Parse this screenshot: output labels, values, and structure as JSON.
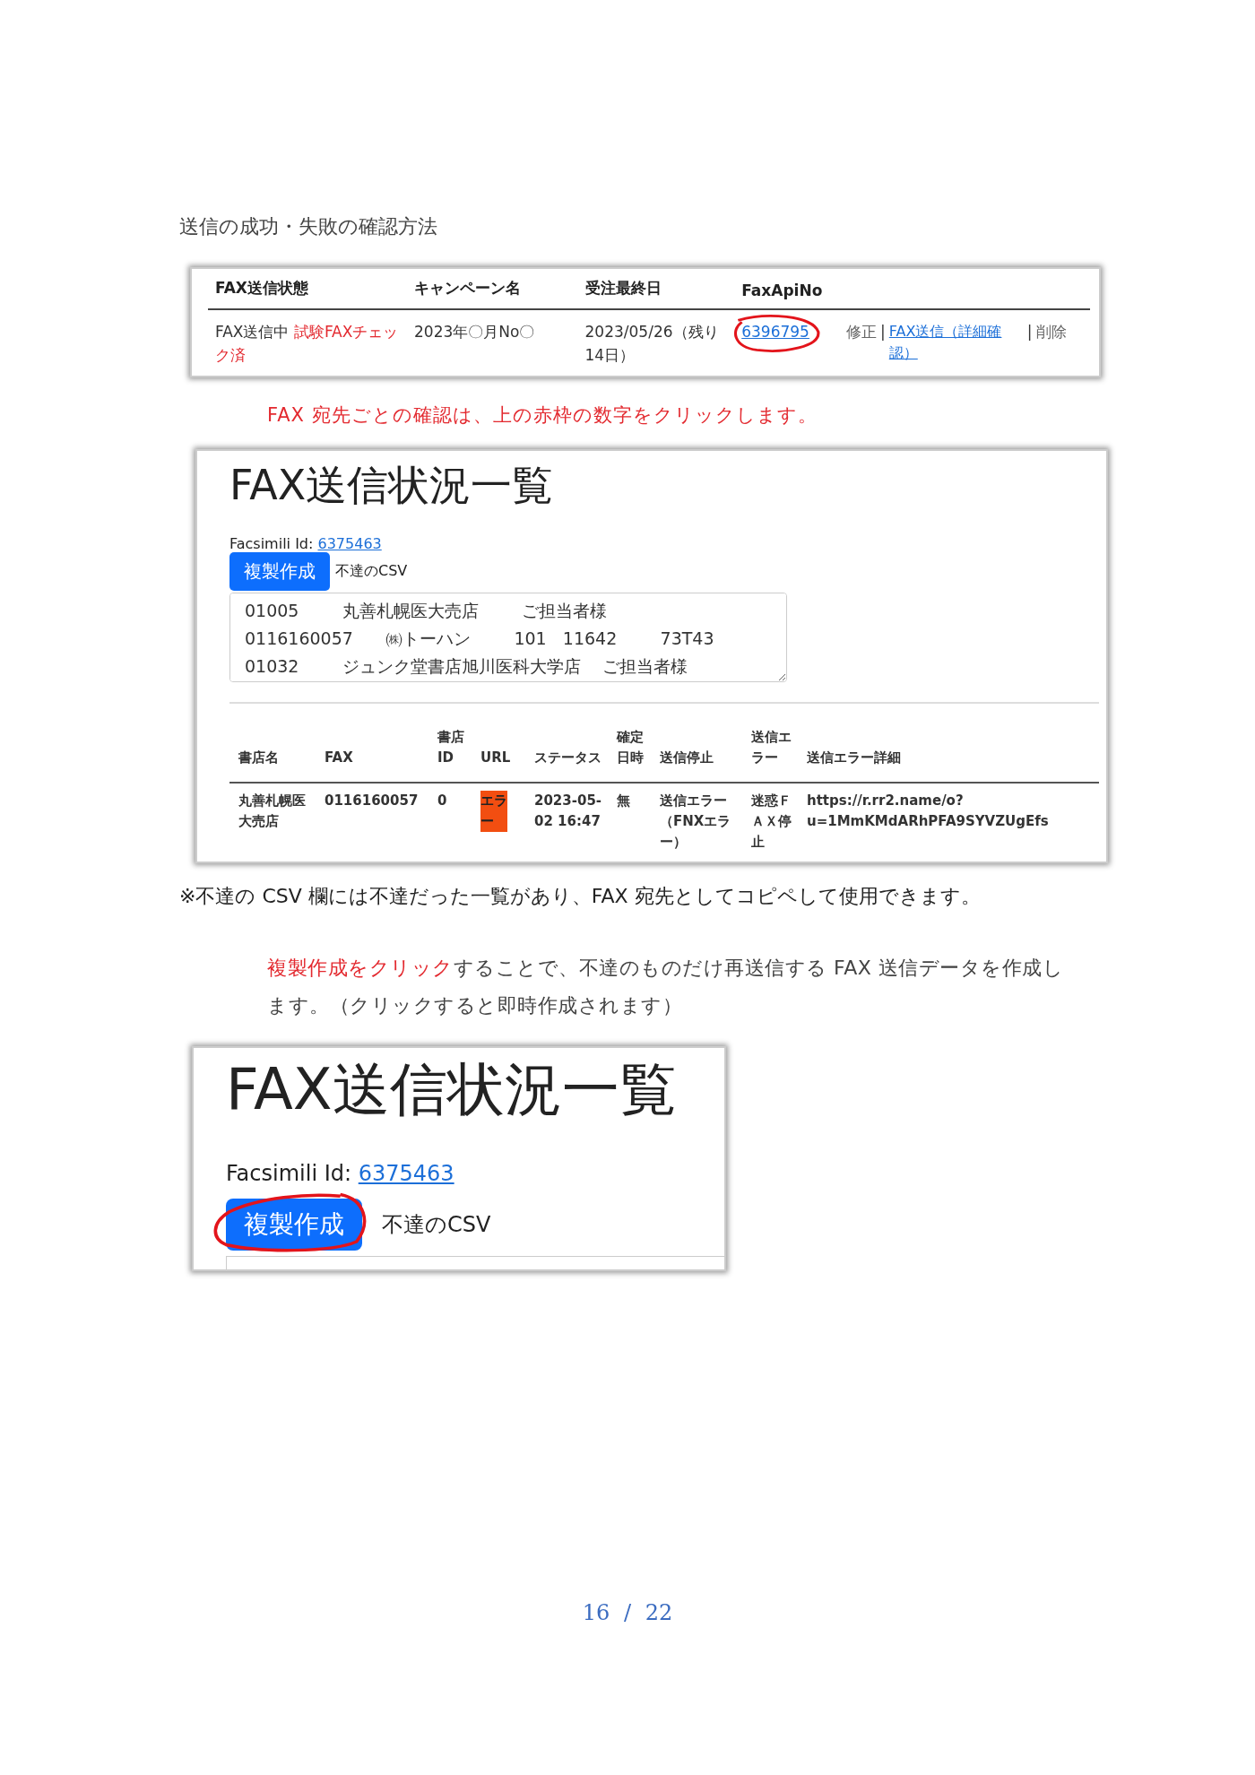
{
  "heading": "送信の成功・失敗の確認方法",
  "campaign_table": {
    "columns": [
      "FAX送信状態",
      "キャンペーン名",
      "受注最終日",
      "FaxApiNo"
    ],
    "rows": [
      {
        "status": [
          {
            "text": "FAX送信中 ",
            "kind": "plain"
          },
          {
            "text": "試験FAXチェック済",
            "kind": "alert"
          }
        ],
        "campaign": "2023年〇月No〇",
        "deadline": "2023/05/26（残り14日）",
        "fax_api_no": "6396795",
        "actions": [
          {
            "label": "修正",
            "kind": "plain"
          },
          {
            "label": "|",
            "kind": "separator"
          },
          {
            "label": "FAX送信（詳細確認）",
            "kind": "link"
          },
          {
            "label": "|",
            "kind": "separator"
          },
          {
            "label": "削除",
            "kind": "plain"
          }
        ]
      }
    ]
  },
  "note_red": "FAX 宛先ごとの確認は、上の赤枠の数字をクリックします。",
  "status_page": {
    "title": "FAX送信状況一覧",
    "id_label": "Facsimili Id:",
    "id_link": "6375463",
    "copy_button": "複製作成",
    "csv_label": "不達のCSV",
    "csv_textarea": {
      "value": "01005        丸善札幌医大売店        ご担当者様\n0116160057      ㈱トーハン        101   11642        73T43\n01032        ジュンク堂書店旭川医科大学店    ご担当者様"
    },
    "columns": [
      "書店名",
      "FAX",
      "書店ID",
      "URL",
      "ステータス",
      "確定日時",
      "送信停止",
      "送信エラー",
      "送信エラー詳細"
    ],
    "rows": [
      {
        "cells": [
          "丸善札幌医大売店",
          "0116160057",
          "0",
          "エラー",
          "2023-05-02 16:47",
          "無",
          "送信エラー（FNXエラー）",
          "迷惑ＦＡＸ停止",
          "https://r.rr2.name/o?u=1MmKMdARhPFA9SYVZUgEfs"
        ],
        "url_error": true
      }
    ]
  },
  "note": "※不達の CSV 欄には不達だった一覧があり、FAX 宛先としてコピペして使用できます。",
  "paragraph": [
    {
      "text": "複製作成をクリック",
      "kind": "alert"
    },
    {
      "text": "することで、不達のものだけ再送信する FAX 送信データを作成します。（クリックすると即時作成されます）",
      "kind": "plain"
    }
  ],
  "zoom_page": {
    "title": "FAX送信状況一覧",
    "id_label": "Facsimili Id:",
    "id_link": "6375463",
    "copy_button": "複製作成",
    "csv_label": "不達のCSV"
  },
  "page_number": "16 / 22"
}
